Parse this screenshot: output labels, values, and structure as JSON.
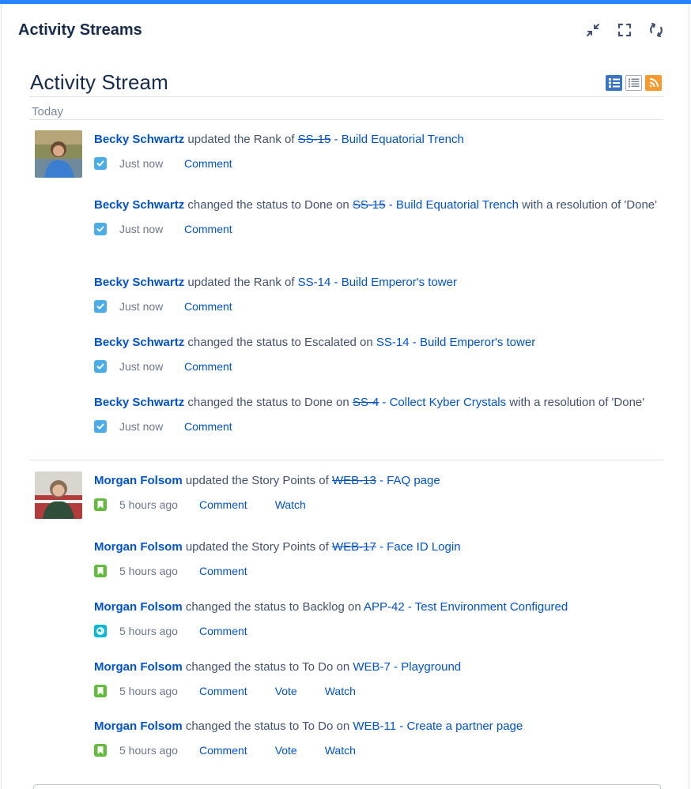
{
  "gadget": {
    "title": "Activity Streams",
    "actions": [
      "minimize-icon",
      "fullscreen-icon",
      "refresh-icon"
    ]
  },
  "stream": {
    "title": "Activity Stream",
    "view_icons": [
      "full-view-icon",
      "list-view-icon",
      "rss-feed-icon"
    ],
    "day_label": "Today"
  },
  "colors": {
    "link": "#0052cc",
    "accent": "#2684ff",
    "task": "#4bade8",
    "story": "#63ba3c",
    "epic": "#00b8d9"
  },
  "entries": [
    {
      "user": "Becky Schwartz",
      "text": " updated the Rank of ",
      "key": "SS-15",
      "key_done": true,
      "summary": " - Build Equatorial Trench",
      "suffix": "",
      "icon": "task",
      "time": "Just now",
      "actions": [
        "Comment"
      ]
    },
    {
      "user": "Becky Schwartz",
      "text": " changed the status to Done on ",
      "key": "SS-15",
      "key_done": true,
      "summary": " - Build Equatorial Trench",
      "suffix": " with a resolution of 'Done'",
      "icon": "task",
      "time": "Just now",
      "actions": [
        "Comment"
      ]
    },
    {
      "user": "Becky Schwartz",
      "text": " updated the Rank of ",
      "key": "SS-14",
      "key_done": false,
      "summary": " - Build Emperor's tower",
      "suffix": "",
      "icon": "task",
      "time": "Just now",
      "actions": [
        "Comment"
      ]
    },
    {
      "user": "Becky Schwartz",
      "text": " changed the status to Escalated on ",
      "key": "SS-14",
      "key_done": false,
      "summary": " - Build Emperor's tower",
      "suffix": "",
      "icon": "task",
      "time": "Just now",
      "actions": [
        "Comment"
      ]
    },
    {
      "user": "Becky Schwartz",
      "text": " changed the status to Done on ",
      "key": "SS-4",
      "key_done": true,
      "summary": " - Collect Kyber Crystals",
      "suffix": " with a resolution of 'Done'",
      "icon": "task",
      "time": "Just now",
      "actions": [
        "Comment"
      ]
    },
    {
      "user": "Morgan Folsom",
      "text": " updated the Story Points of ",
      "key": "WEB-13",
      "key_done": true,
      "summary": " - FAQ page",
      "suffix": "",
      "icon": "story",
      "time": "5 hours ago",
      "actions": [
        "Comment",
        "Watch"
      ]
    },
    {
      "user": "Morgan Folsom",
      "text": " updated the Story Points of ",
      "key": "WEB-17",
      "key_done": true,
      "summary": " - Face ID Login",
      "suffix": "",
      "icon": "story",
      "time": "5 hours ago",
      "actions": [
        "Comment"
      ]
    },
    {
      "user": "Morgan Folsom",
      "text": " changed the status to Backlog on ",
      "key": "APP-42",
      "key_done": false,
      "summary": " - Test Environment Configured",
      "suffix": "",
      "icon": "epic",
      "time": "5 hours ago",
      "actions": [
        "Comment"
      ]
    },
    {
      "user": "Morgan Folsom",
      "text": " changed the status to To Do on ",
      "key": "WEB-7",
      "key_done": false,
      "summary": " - Playground",
      "suffix": "",
      "icon": "story",
      "time": "5 hours ago",
      "actions": [
        "Comment",
        "Vote",
        "Watch"
      ]
    },
    {
      "user": "Morgan Folsom",
      "text": " changed the status to To Do on ",
      "key": "WEB-11",
      "key_done": false,
      "summary": " - Create a partner page",
      "suffix": "",
      "icon": "story",
      "time": "5 hours ago",
      "actions": [
        "Comment",
        "Vote",
        "Watch"
      ]
    }
  ]
}
